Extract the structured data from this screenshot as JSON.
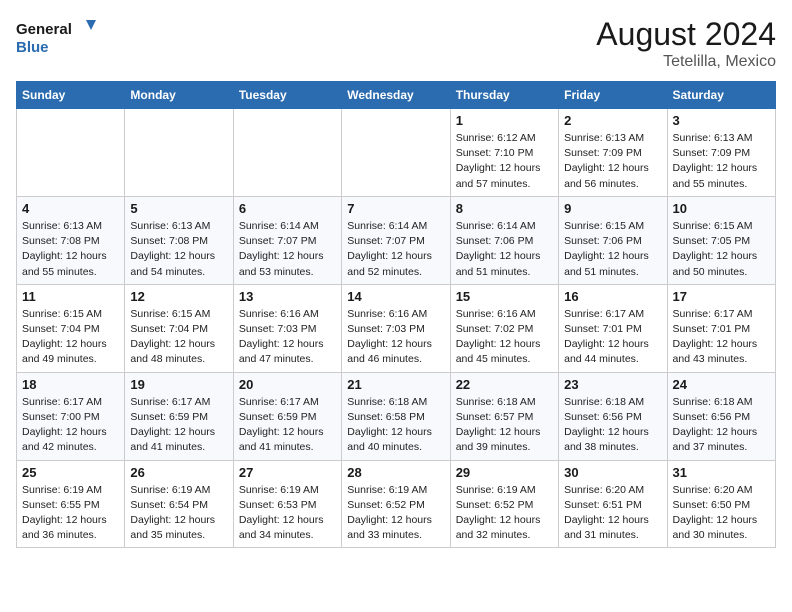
{
  "logo": {
    "line1": "General",
    "line2": "Blue"
  },
  "title": "August 2024",
  "location": "Tetelilla, Mexico",
  "days_of_week": [
    "Sunday",
    "Monday",
    "Tuesday",
    "Wednesday",
    "Thursday",
    "Friday",
    "Saturday"
  ],
  "weeks": [
    [
      {
        "day": "",
        "info": ""
      },
      {
        "day": "",
        "info": ""
      },
      {
        "day": "",
        "info": ""
      },
      {
        "day": "",
        "info": ""
      },
      {
        "day": "1",
        "info": "Sunrise: 6:12 AM\nSunset: 7:10 PM\nDaylight: 12 hours\nand 57 minutes."
      },
      {
        "day": "2",
        "info": "Sunrise: 6:13 AM\nSunset: 7:09 PM\nDaylight: 12 hours\nand 56 minutes."
      },
      {
        "day": "3",
        "info": "Sunrise: 6:13 AM\nSunset: 7:09 PM\nDaylight: 12 hours\nand 55 minutes."
      }
    ],
    [
      {
        "day": "4",
        "info": "Sunrise: 6:13 AM\nSunset: 7:08 PM\nDaylight: 12 hours\nand 55 minutes."
      },
      {
        "day": "5",
        "info": "Sunrise: 6:13 AM\nSunset: 7:08 PM\nDaylight: 12 hours\nand 54 minutes."
      },
      {
        "day": "6",
        "info": "Sunrise: 6:14 AM\nSunset: 7:07 PM\nDaylight: 12 hours\nand 53 minutes."
      },
      {
        "day": "7",
        "info": "Sunrise: 6:14 AM\nSunset: 7:07 PM\nDaylight: 12 hours\nand 52 minutes."
      },
      {
        "day": "8",
        "info": "Sunrise: 6:14 AM\nSunset: 7:06 PM\nDaylight: 12 hours\nand 51 minutes."
      },
      {
        "day": "9",
        "info": "Sunrise: 6:15 AM\nSunset: 7:06 PM\nDaylight: 12 hours\nand 51 minutes."
      },
      {
        "day": "10",
        "info": "Sunrise: 6:15 AM\nSunset: 7:05 PM\nDaylight: 12 hours\nand 50 minutes."
      }
    ],
    [
      {
        "day": "11",
        "info": "Sunrise: 6:15 AM\nSunset: 7:04 PM\nDaylight: 12 hours\nand 49 minutes."
      },
      {
        "day": "12",
        "info": "Sunrise: 6:15 AM\nSunset: 7:04 PM\nDaylight: 12 hours\nand 48 minutes."
      },
      {
        "day": "13",
        "info": "Sunrise: 6:16 AM\nSunset: 7:03 PM\nDaylight: 12 hours\nand 47 minutes."
      },
      {
        "day": "14",
        "info": "Sunrise: 6:16 AM\nSunset: 7:03 PM\nDaylight: 12 hours\nand 46 minutes."
      },
      {
        "day": "15",
        "info": "Sunrise: 6:16 AM\nSunset: 7:02 PM\nDaylight: 12 hours\nand 45 minutes."
      },
      {
        "day": "16",
        "info": "Sunrise: 6:17 AM\nSunset: 7:01 PM\nDaylight: 12 hours\nand 44 minutes."
      },
      {
        "day": "17",
        "info": "Sunrise: 6:17 AM\nSunset: 7:01 PM\nDaylight: 12 hours\nand 43 minutes."
      }
    ],
    [
      {
        "day": "18",
        "info": "Sunrise: 6:17 AM\nSunset: 7:00 PM\nDaylight: 12 hours\nand 42 minutes."
      },
      {
        "day": "19",
        "info": "Sunrise: 6:17 AM\nSunset: 6:59 PM\nDaylight: 12 hours\nand 41 minutes."
      },
      {
        "day": "20",
        "info": "Sunrise: 6:17 AM\nSunset: 6:59 PM\nDaylight: 12 hours\nand 41 minutes."
      },
      {
        "day": "21",
        "info": "Sunrise: 6:18 AM\nSunset: 6:58 PM\nDaylight: 12 hours\nand 40 minutes."
      },
      {
        "day": "22",
        "info": "Sunrise: 6:18 AM\nSunset: 6:57 PM\nDaylight: 12 hours\nand 39 minutes."
      },
      {
        "day": "23",
        "info": "Sunrise: 6:18 AM\nSunset: 6:56 PM\nDaylight: 12 hours\nand 38 minutes."
      },
      {
        "day": "24",
        "info": "Sunrise: 6:18 AM\nSunset: 6:56 PM\nDaylight: 12 hours\nand 37 minutes."
      }
    ],
    [
      {
        "day": "25",
        "info": "Sunrise: 6:19 AM\nSunset: 6:55 PM\nDaylight: 12 hours\nand 36 minutes."
      },
      {
        "day": "26",
        "info": "Sunrise: 6:19 AM\nSunset: 6:54 PM\nDaylight: 12 hours\nand 35 minutes."
      },
      {
        "day": "27",
        "info": "Sunrise: 6:19 AM\nSunset: 6:53 PM\nDaylight: 12 hours\nand 34 minutes."
      },
      {
        "day": "28",
        "info": "Sunrise: 6:19 AM\nSunset: 6:52 PM\nDaylight: 12 hours\nand 33 minutes."
      },
      {
        "day": "29",
        "info": "Sunrise: 6:19 AM\nSunset: 6:52 PM\nDaylight: 12 hours\nand 32 minutes."
      },
      {
        "day": "30",
        "info": "Sunrise: 6:20 AM\nSunset: 6:51 PM\nDaylight: 12 hours\nand 31 minutes."
      },
      {
        "day": "31",
        "info": "Sunrise: 6:20 AM\nSunset: 6:50 PM\nDaylight: 12 hours\nand 30 minutes."
      }
    ]
  ]
}
